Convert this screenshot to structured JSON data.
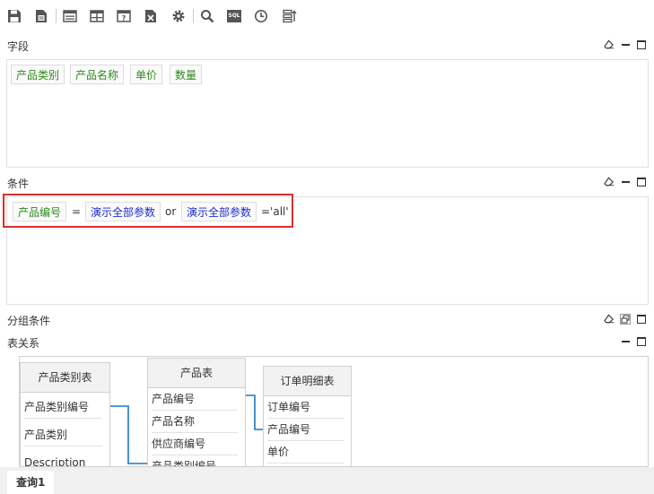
{
  "toolbar": {
    "sql_label": "SQL"
  },
  "sections": {
    "fields": {
      "title": "字段",
      "tags": [
        "产品类别",
        "产品名称",
        "单价",
        "数量"
      ]
    },
    "conditions": {
      "title": "条件",
      "field": "产品编号",
      "op_eq": "=",
      "param1": "演示全部参数",
      "op_or": "or",
      "param2": "演示全部参数",
      "literal": "='all'"
    },
    "group": {
      "title": "分组条件"
    },
    "relations": {
      "title": "表关系"
    }
  },
  "tables": [
    {
      "name": "产品类别表",
      "columns": [
        "产品类别编号",
        "产品类别",
        "Description"
      ]
    },
    {
      "name": "产品表",
      "columns": [
        "产品编号",
        "产品名称",
        "供应商编号",
        "产品类别编号"
      ]
    },
    {
      "name": "订单明细表",
      "columns": [
        "订单编号",
        "产品编号",
        "单价"
      ]
    }
  ],
  "tabs": [
    "查询1"
  ],
  "colors": {
    "field_tag": "#2e8b1e",
    "param_tag": "#1c2bd0",
    "highlight": "#d9302b",
    "link": "#1a78c2"
  }
}
